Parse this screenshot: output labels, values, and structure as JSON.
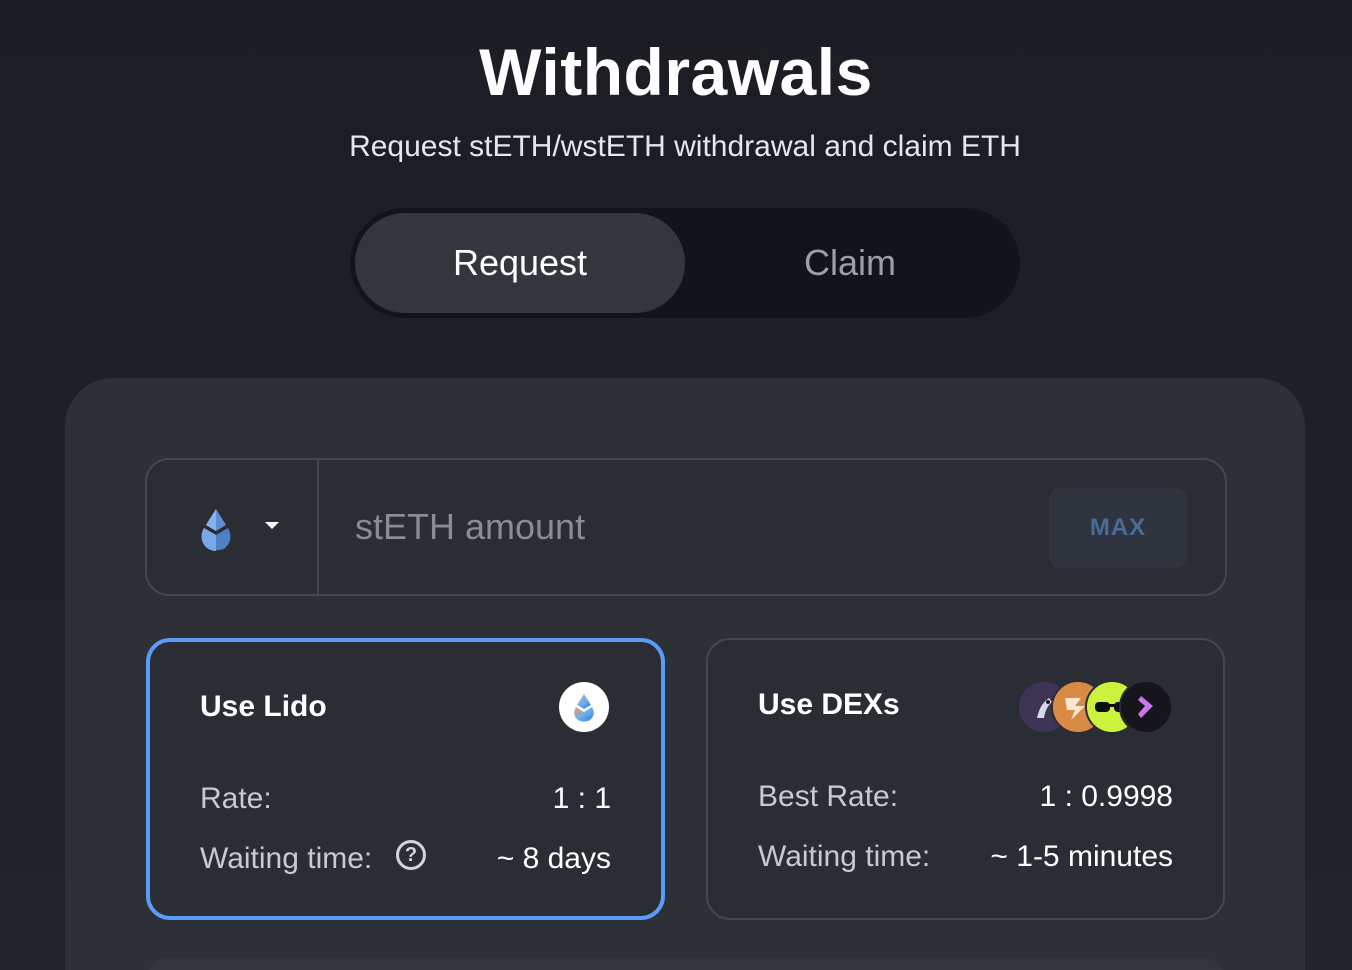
{
  "header": {
    "title": "Withdrawals",
    "subtitle": "Request stETH/wstETH withdrawal and claim ETH"
  },
  "tabs": [
    {
      "label": "Request",
      "active": true
    },
    {
      "label": "Claim",
      "active": false
    }
  ],
  "form": {
    "token_icon": "steth-droplet-icon",
    "amount_placeholder": "stETH amount",
    "amount_value": "",
    "max_label": "MAX"
  },
  "options": {
    "lido": {
      "title": "Use Lido",
      "selected": true,
      "icon": "lido-logo-icon",
      "rate_label": "Rate:",
      "rate_value": "1 : 1",
      "waiting_label": "Waiting time:",
      "waiting_value": "~ 8 days",
      "help_icon_text": "?"
    },
    "dex": {
      "title": "Use DEXs",
      "selected": false,
      "icons": [
        "1inch-logo-icon",
        "paraswap-logo-icon",
        "cowswap-logo-icon",
        "bebop-logo-icon"
      ],
      "rate_label": "Best Rate:",
      "rate_value": "1 : 0.9998",
      "waiting_label": "Waiting time:",
      "waiting_value": "~ 1-5 minutes"
    }
  },
  "colors": {
    "background": "#1f2128",
    "card": "#2e3038",
    "selected_border": "#5a9cf5",
    "max_text": "#4a6b99"
  }
}
